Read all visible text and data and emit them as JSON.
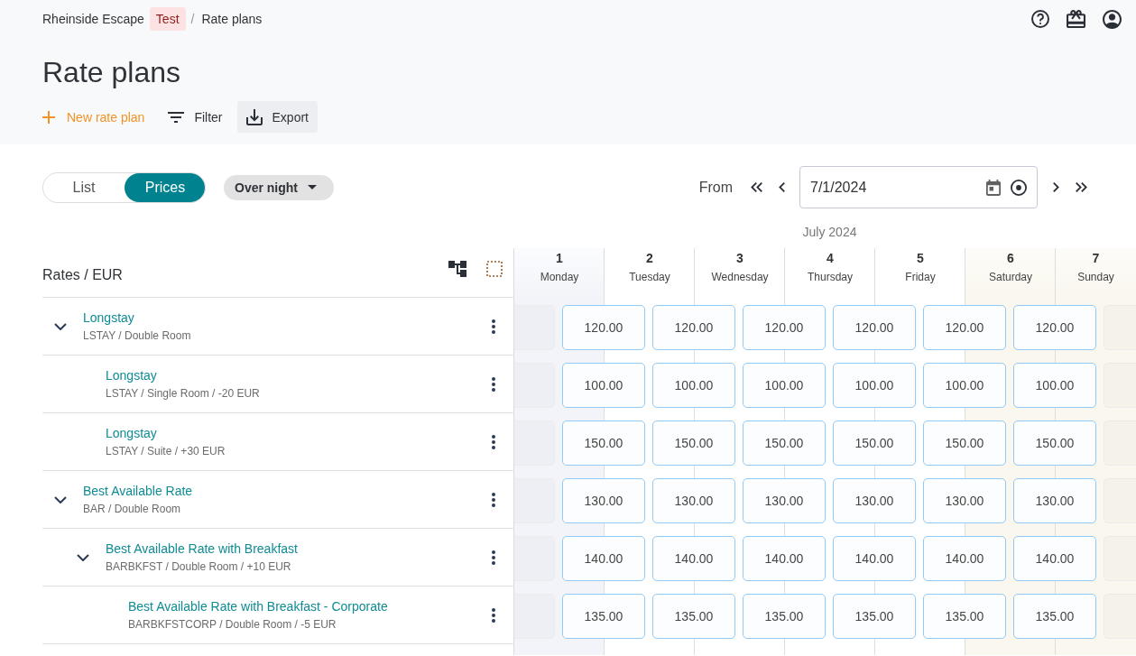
{
  "breadcrumb": [
    {
      "kind": "link",
      "label": "Rheinside Escape"
    },
    {
      "kind": "badge",
      "label": "Test"
    },
    {
      "kind": "separator",
      "label": "/"
    },
    {
      "kind": "current",
      "label": "Rate plans"
    }
  ],
  "title": "Rate plans",
  "toolbar": [
    {
      "kind": "add",
      "label": "New rate plan",
      "hovered": false
    },
    {
      "kind": "filter",
      "label": "Filter",
      "hovered": false
    },
    {
      "kind": "export",
      "label": "Export",
      "hovered": true
    }
  ],
  "view_toggle": [
    {
      "label": "List",
      "selected": false
    },
    {
      "label": "Prices",
      "selected": true
    }
  ],
  "period_dropdown": {
    "value": "Over night"
  },
  "date_navigation": {
    "label": "From",
    "value": "7/1/2024"
  },
  "grid": {
    "month": "July 2024",
    "heading": "Rates / EUR",
    "days": [
      {
        "day": "1",
        "weekday": "Monday",
        "today": true,
        "weekend": false
      },
      {
        "day": "2",
        "weekday": "Tuesday",
        "today": false,
        "weekend": false
      },
      {
        "day": "3",
        "weekday": "Wednesday",
        "today": false,
        "weekend": false
      },
      {
        "day": "4",
        "weekday": "Thursday",
        "today": false,
        "weekend": false
      },
      {
        "day": "5",
        "weekday": "Friday",
        "today": false,
        "weekend": false
      },
      {
        "day": "6",
        "weekday": "Saturday",
        "today": false,
        "weekend": true
      },
      {
        "day": "7",
        "weekday": "Sunday",
        "today": false,
        "weekend": true
      }
    ],
    "rates": [
      {
        "name": "Longstay",
        "details": "LSTAY / Double Room",
        "expanded": true,
        "prices": [
          "120.00",
          "120.00",
          "120.00",
          "120.00",
          "120.00",
          "120.00"
        ],
        "children": [
          {
            "name": "Longstay",
            "details": "LSTAY / Single Room / -20 EUR",
            "prices": [
              "100.00",
              "100.00",
              "100.00",
              "100.00",
              "100.00",
              "100.00"
            ]
          },
          {
            "name": "Longstay",
            "details": "LSTAY / Suite / +30 EUR",
            "prices": [
              "150.00",
              "150.00",
              "150.00",
              "150.00",
              "150.00",
              "150.00"
            ]
          }
        ]
      },
      {
        "name": "Best Available Rate",
        "details": "BAR / Double Room",
        "expanded": true,
        "prices": [
          "130.00",
          "130.00",
          "130.00",
          "130.00",
          "130.00",
          "130.00"
        ],
        "children": [
          {
            "name": "Best Available Rate with Breakfast",
            "details": "BARBKFST / Double Room / +10 EUR",
            "expanded": true,
            "prices": [
              "140.00",
              "140.00",
              "140.00",
              "140.00",
              "140.00",
              "140.00"
            ],
            "children": [
              {
                "name": "Best Available Rate with Breakfast - Corporate",
                "details": "BARBKFSTCORP / Double Room / -5 EUR",
                "prices": [
                  "135.00",
                  "135.00",
                  "135.00",
                  "135.00",
                  "135.00",
                  "135.00"
                ]
              }
            ]
          }
        ]
      }
    ]
  }
}
